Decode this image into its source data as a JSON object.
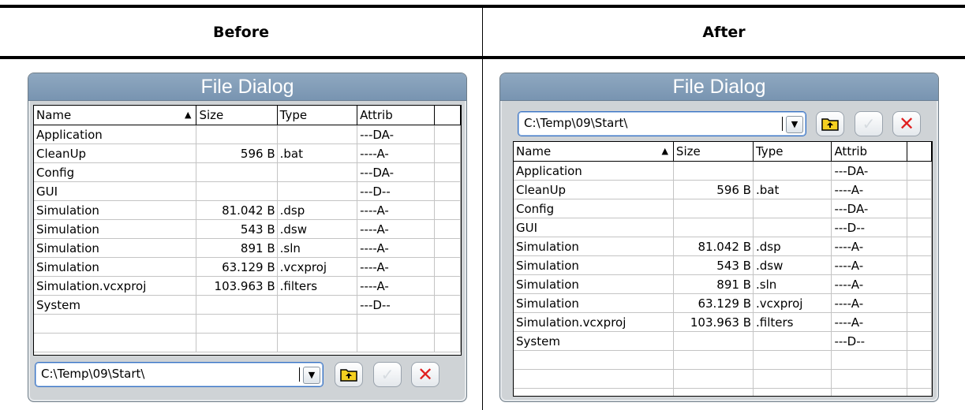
{
  "columns": {
    "before": "Before",
    "after": "After"
  },
  "dialog": {
    "title": "File Dialog",
    "path": "C:\\Temp\\09\\Start\\",
    "headers": [
      "Name",
      "Size",
      "Type",
      "Attrib"
    ],
    "sort_indicator": "▲",
    "dropdown_glyph": "▼",
    "ok_glyph": "✓",
    "cancel_glyph": "✕",
    "rows": [
      {
        "name": "Application",
        "size": "",
        "type": "",
        "attrib": "---DA-"
      },
      {
        "name": "CleanUp",
        "size": "596 B",
        "type": ".bat",
        "attrib": "----A-"
      },
      {
        "name": "Config",
        "size": "",
        "type": "",
        "attrib": "---DA-"
      },
      {
        "name": "GUI",
        "size": "",
        "type": "",
        "attrib": "---D--"
      },
      {
        "name": "Simulation",
        "size": "81.042 B",
        "type": ".dsp",
        "attrib": "----A-"
      },
      {
        "name": "Simulation",
        "size": "543 B",
        "type": ".dsw",
        "attrib": "----A-"
      },
      {
        "name": "Simulation",
        "size": "891 B",
        "type": ".sln",
        "attrib": "----A-"
      },
      {
        "name": "Simulation",
        "size": "63.129 B",
        "type": ".vcxproj",
        "attrib": "----A-"
      },
      {
        "name": "Simulation.vcxproj",
        "size": "103.963 B",
        "type": ".filters",
        "attrib": "----A-"
      },
      {
        "name": "System",
        "size": "",
        "type": "",
        "attrib": "---D--"
      }
    ]
  }
}
